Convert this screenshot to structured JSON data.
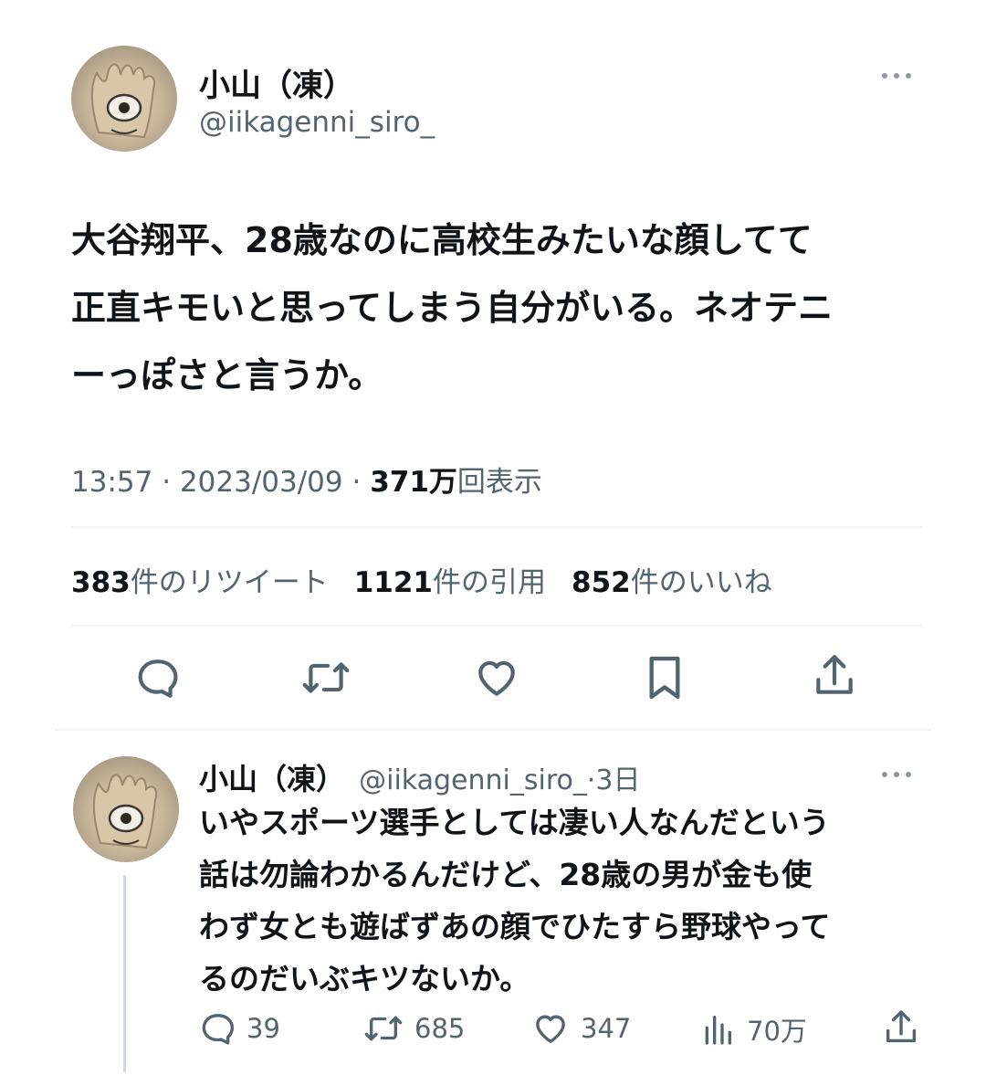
{
  "main_tweet": {
    "author_name": "小山（凍）",
    "author_handle": "@iikagenni_siro_",
    "text_lines": [
      "大谷翔平、28歳なのに高校生みたいな顔してて",
      "正直キモいと思ってしまう自分がいる。ネオテニ",
      "ーっぽさと言うか。"
    ],
    "time": "13:57",
    "date": "2023/03/09",
    "separator": "·",
    "views_count": "371万",
    "views_label": "回表示",
    "retweets_count": "383",
    "retweets_label": "件のリツイート",
    "quotes_count": "1121",
    "quotes_label": "件の引用",
    "likes_count": "852",
    "likes_label": "件のいいね",
    "actions": [
      "reply-icon",
      "retweet-icon",
      "like-icon",
      "bookmark-icon",
      "share-icon"
    ]
  },
  "reply_tweet": {
    "author_name": "小山（凍）",
    "author_handle": "@iikagenni_siro_",
    "age": "·3日",
    "text_lines": [
      "いやスポーツ選手としては凄い人なんだという",
      "話は勿論わかるんだけど、28歳の男が金も使",
      "わず女とも遊ばずあの顔でひたすら野球やって",
      "るのだいぶキツないか。"
    ],
    "reply_count": "39",
    "retweet_count": "685",
    "like_count": "347",
    "views_count": "70万"
  },
  "colors": {
    "text_primary": "#0f1419",
    "text_secondary": "#536471",
    "divider": "#eff3f4",
    "thread_line": "#cfd9de"
  }
}
